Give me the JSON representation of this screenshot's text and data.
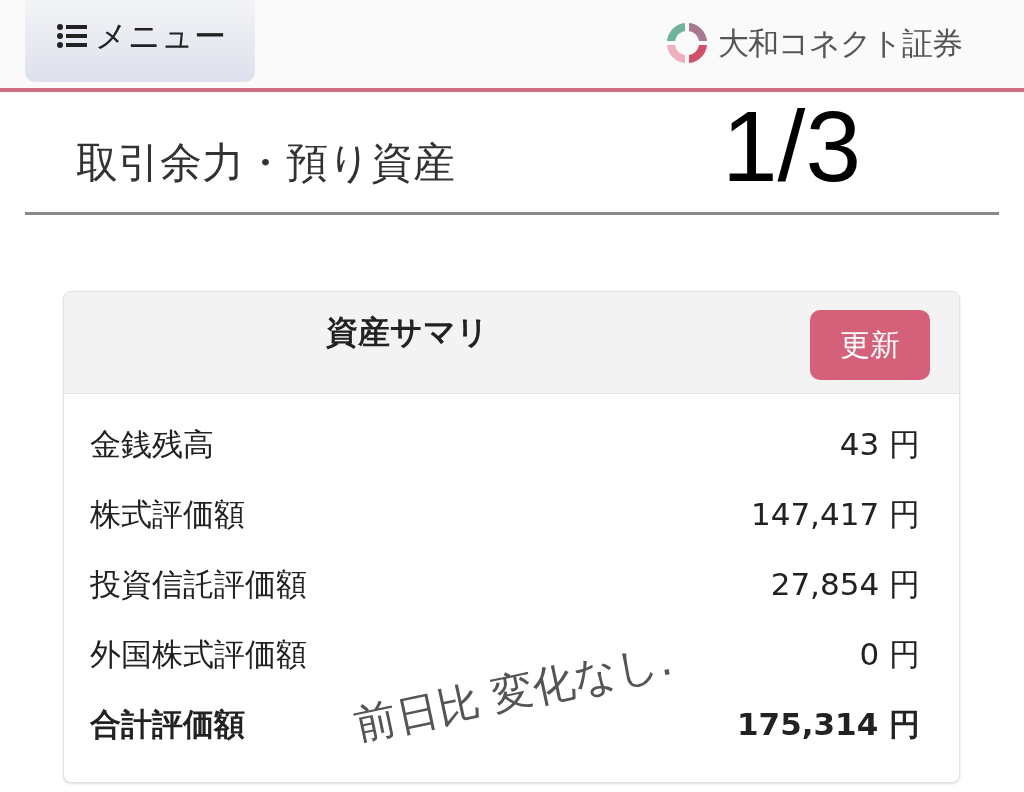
{
  "header": {
    "menu_button": "メニュー",
    "logo_text": "大和コネクト証券"
  },
  "page_title": "取引余力・預り資産",
  "annotations": [
    {
      "kind": "page",
      "text": "1/3"
    },
    {
      "kind": "note",
      "text": "前日比 変化なし."
    }
  ],
  "summary": {
    "title": "資産サマリ",
    "refresh_button": "更新",
    "rows": [
      {
        "kind": "item",
        "label": "金銭残高",
        "value": "43 円"
      },
      {
        "kind": "item",
        "label": "株式評価額",
        "value": "147,417 円"
      },
      {
        "kind": "item",
        "label": "投資信託評価額",
        "value": "27,854 円"
      },
      {
        "kind": "item",
        "label": "外国株式評価額",
        "value": "0 円"
      },
      {
        "kind": "total",
        "label": "合計評価額",
        "value": "175,314 円"
      }
    ]
  }
}
